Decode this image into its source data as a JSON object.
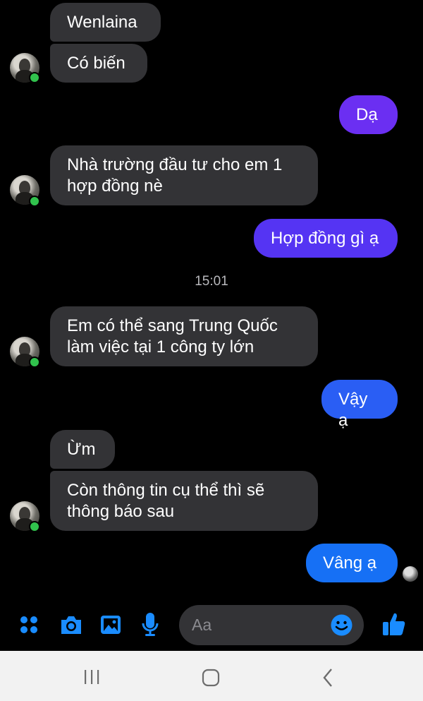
{
  "messages": [
    {
      "text": "Wenlaina",
      "side": "in"
    },
    {
      "text": "Có biến",
      "side": "in"
    },
    {
      "text": "Dạ",
      "side": "out"
    },
    {
      "text": "Nhà trường đầu tư cho em 1\nhợp đồng nè",
      "side": "in"
    },
    {
      "text": "Hợp đồng gì ạ",
      "side": "out"
    },
    {
      "text": "Em có thể sang Trung Quốc\nlàm việc tại 1 công ty lớn",
      "side": "in"
    },
    {
      "text": "Vậy ạ",
      "side": "out"
    },
    {
      "text": "Ừm",
      "side": "in"
    },
    {
      "text": "Còn thông tin cụ thể thì sẽ\nthông báo sau",
      "side": "in"
    },
    {
      "text": "Vâng ạ",
      "side": "out"
    }
  ],
  "timestamp": "15:01",
  "composer": {
    "placeholder": "Aa",
    "icons": [
      "apps-icon",
      "camera-icon",
      "gallery-icon",
      "microphone-icon",
      "emoji-icon",
      "like-icon"
    ]
  },
  "colors": {
    "incoming_bubble": "#333336",
    "outgoing_purple": "#6b2ff2",
    "outgoing_blue": "#1670f5",
    "accent": "#1a8cff",
    "online": "#31c24d"
  },
  "navbar": {
    "icons": [
      "recent-apps-icon",
      "home-icon",
      "back-icon"
    ]
  }
}
